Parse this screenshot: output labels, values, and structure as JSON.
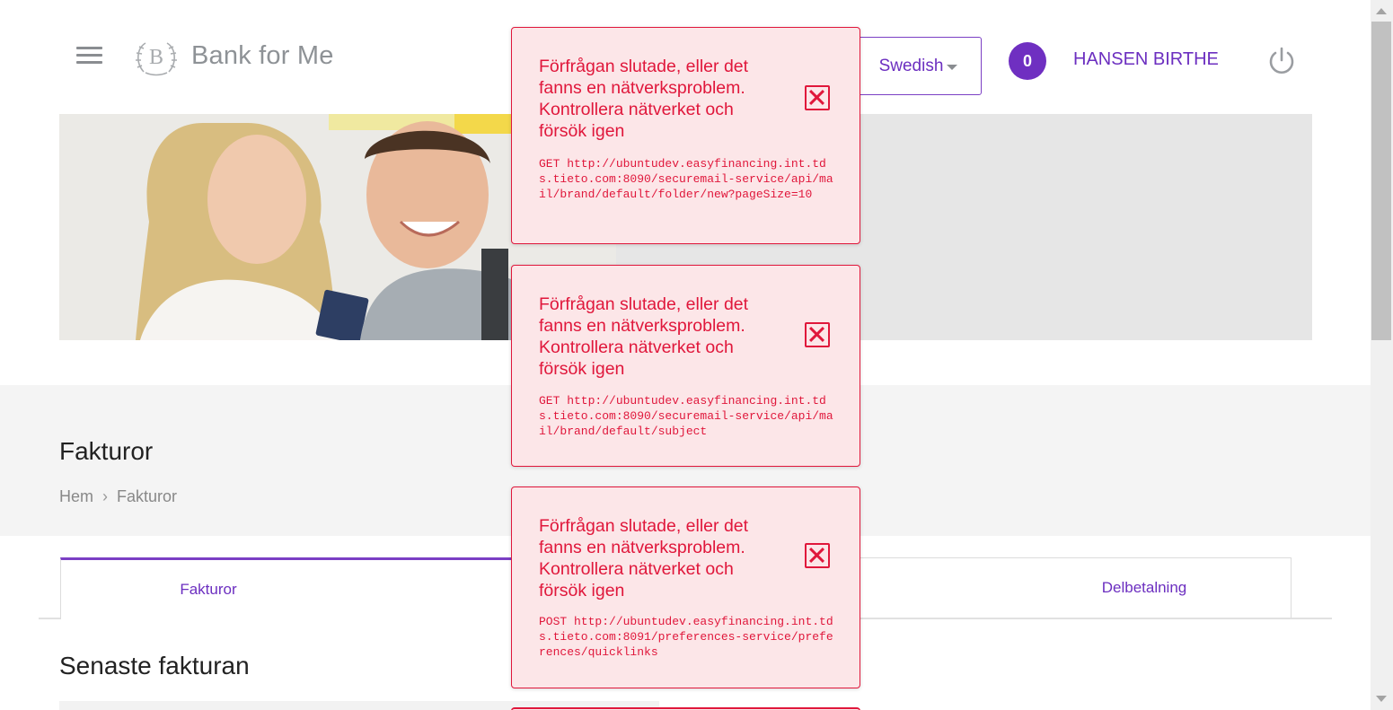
{
  "header": {
    "brand": "Bank for Me",
    "logo_letter": "B",
    "language": "Swedish",
    "notification_count": "0",
    "user_name": "HANSEN BIRTHE"
  },
  "page": {
    "title": "Fakturor",
    "breadcrumb": [
      "Hem",
      "Fakturor"
    ],
    "section_title": "Senaste fakturan"
  },
  "tabs": [
    {
      "label": "Fakturor",
      "active": true
    },
    {
      "label": "Delbetalning",
      "active": false
    }
  ],
  "errors": [
    {
      "message": "Förfrågan slutade, eller det fanns en nätverksproblem. Kontrollera nätverket och försök igen",
      "request": "GET http://ubuntudev.easyfinancing.int.tds.tieto.com:8090/securemail-service/api/mail/brand/default/folder/new?pageSize=10"
    },
    {
      "message": "Förfrågan slutade, eller det fanns en nätverksproblem. Kontrollera nätverket och försök igen",
      "request": "GET http://ubuntudev.easyfinancing.int.tds.tieto.com:8090/securemail-service/api/mail/brand/default/subject"
    },
    {
      "message": "Förfrågan slutade, eller det fanns en nätverksproblem. Kontrollera nätverket och försök igen",
      "request": "POST http://ubuntudev.easyfinancing.int.tds.tieto.com:8091/preferences-service/preferences/quicklinks"
    }
  ],
  "colors": {
    "accent": "#6f2fc1",
    "error": "#e0173b",
    "error_bg": "#fce6e8"
  },
  "icons": [
    "menu-icon",
    "bank-logo-icon",
    "caret-down-icon",
    "power-icon",
    "close-icon"
  ]
}
